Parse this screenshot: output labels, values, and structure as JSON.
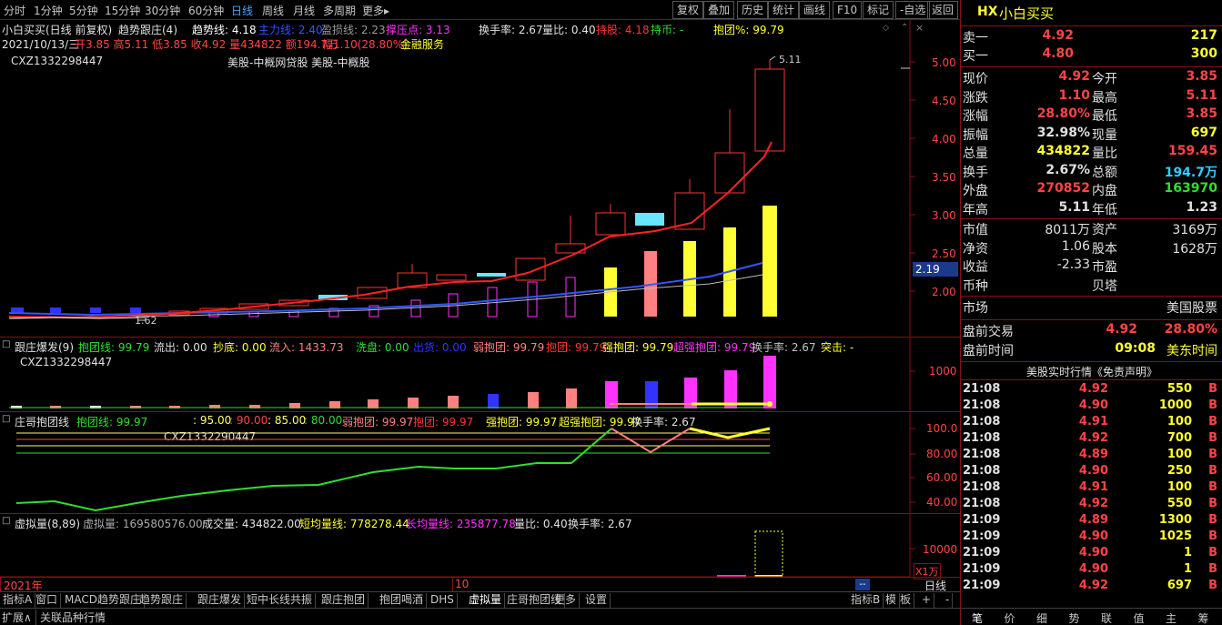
{
  "toolbar": {
    "periods": [
      "分时",
      "1分钟",
      "5分钟",
      "15分钟",
      "30分钟",
      "60分钟",
      "日线",
      "周线",
      "月线",
      "多周期",
      "更多▸"
    ],
    "active": "日线",
    "right_buttons": [
      "复权",
      "叠加",
      "历史",
      "统计",
      "画线",
      "F10",
      "标记",
      "-自选",
      "返回"
    ]
  },
  "main_header": {
    "title": "小白买买(日线 前复权)",
    "indicator": "趋势跟庄(4)",
    "trend_label": "趋势线: 4.18",
    "main_label": "主力线: 2.40",
    "stoploss_label": "盈损线: 2.23",
    "pressure_label": "撑压点: 3.13",
    "turnover": "换手率: 2.67",
    "volratio": "量比: 0.40",
    "holdstock": "持股: 4.18",
    "holdcoin": "持币: -",
    "hugpct": "抱团%: 99.79",
    "date_line_date": "2021/10/13/三",
    "date_line_rest": "开3.85 高5.11 低3.85 收4.92 量434822 额194.7万",
    "pct_text": "幅1.10(28.80%)",
    "finance": "金融服务",
    "code": "CXZ1332298447",
    "sector": "美股-中概网贷股 美股-中概股",
    "high_mark": "5.11",
    "low_mark": "1.62",
    "yaxis": [
      "5.00",
      "4.50",
      "4.00",
      "3.50",
      "3.00",
      "2.50",
      "2.00"
    ],
    "price_tag": "2.19"
  },
  "panel2": {
    "name": "跟庄爆发(9)",
    "items": [
      {
        "t": "抱团线: 99.79",
        "c": "#33dd33"
      },
      {
        "t": "流出: 0.00",
        "c": "#e0e0e0"
      },
      {
        "t": "抄底: 0.00",
        "c": "#ffff33"
      },
      {
        "t": "流入: 1433.73",
        "c": "#ff8080"
      },
      {
        "t": "洗盘: 0.00",
        "c": "#33dd33"
      },
      {
        "t": "出货: 0.00",
        "c": "#3333ff"
      },
      {
        "t": "弱抱团: 99.79",
        "c": "#ff8080"
      },
      {
        "t": "抱团: 99.79",
        "c": "#ff3333"
      },
      {
        "t": "强抱团: 99.79",
        "c": "#ffff33"
      },
      {
        "t": "超强抱团: 99.79",
        "c": "#ff33ff"
      },
      {
        "t": "换手率: 2.67",
        "c": "#c0c0c0"
      },
      {
        "t": "突击: -",
        "c": "#ffff33"
      }
    ],
    "code": "CXZ1332298447",
    "yaxis": [
      "1000"
    ]
  },
  "panel3": {
    "name": "庄哥抱团线",
    "items": [
      {
        "t": "抱团线: 99.97",
        "c": "#33dd33"
      },
      {
        "t": ": 95.00",
        "c": "#ffff66"
      },
      {
        "t": ": 90.00",
        "c": "#ff4444"
      },
      {
        "t": ": 85.00",
        "c": "#ffff66"
      },
      {
        "t": ": 80.00",
        "c": "#33dd33"
      },
      {
        "t": "弱抱团: 99.97",
        "c": "#ff8080"
      },
      {
        "t": "抱团: 99.97",
        "c": "#ff3333"
      },
      {
        "t": "强抱团: 99.97",
        "c": "#ffff33"
      },
      {
        "t": "超强抱团: 99.97",
        "c": "#ffff33"
      },
      {
        "t": "换手率: 2.67",
        "c": "#e0e0e0"
      }
    ],
    "code": "CXZ1332290447",
    "yaxis": [
      "100.0",
      "80.00",
      "60.00",
      "40.00"
    ]
  },
  "panel4": {
    "name": "虚拟量(8,89)",
    "vvol": "虚拟量: 169580576.00",
    "vol": "成交量: 434822.00",
    "short": "短均量线: 778278.44",
    "long": "长均量线: 235877.78",
    "ratio": "量比: 0.40",
    "turn": "换手率: 2.67",
    "yaxis": [
      "10000"
    ],
    "unit": "X1万"
  },
  "timeaxis": {
    "year": "2021年",
    "month": "10",
    "period": "日线"
  },
  "bottom_tabs": [
    "指标A",
    "窗口",
    "MACD趋势跟庄",
    "趋势跟庄",
    "跟庄爆发",
    "短中长线共振",
    "跟庄抱团",
    "抱团喝酒",
    "DHS",
    "虚拟量",
    "庄哥抱团线",
    "更多",
    "设置"
  ],
  "bottom_right_tabs": [
    "指标B",
    "模",
    "板",
    "+",
    "-"
  ],
  "bottom_bar": [
    "扩展∧",
    "关联品种行情"
  ],
  "right_panel": {
    "logo": "HX",
    "name": "小白买买",
    "sell1": {
      "label": "卖一",
      "price": "4.92",
      "vol": "217"
    },
    "buy1": {
      "label": "买一",
      "price": "4.80",
      "vol": "300"
    },
    "quotes": [
      {
        "l1": "现价",
        "v1": "4.92",
        "c1": "#ff4444",
        "l2": "今开",
        "v2": "3.85",
        "c2": "#ff4444"
      },
      {
        "l1": "涨跌",
        "v1": "1.10",
        "c1": "#ff4444",
        "l2": "最高",
        "v2": "5.11",
        "c2": "#ff4444"
      },
      {
        "l1": "涨幅",
        "v1": "28.80%",
        "c1": "#ff4444",
        "l2": "最低",
        "v2": "3.85",
        "c2": "#ff4444"
      },
      {
        "l1": "振幅",
        "v1": "32.98%",
        "c1": "#e0e0e0",
        "l2": "现量",
        "v2": "697",
        "c2": "#ffff33"
      },
      {
        "l1": "总量",
        "v1": "434822",
        "c1": "#ffff33",
        "l2": "量比",
        "v2": "159.45",
        "c2": "#ff4444"
      },
      {
        "l1": "换手",
        "v1": "2.67%",
        "c1": "#e0e0e0",
        "l2": "总额",
        "v2": "194.7万",
        "c2": "#33ccff"
      },
      {
        "l1": "外盘",
        "v1": "270852",
        "c1": "#ff4444",
        "l2": "内盘",
        "v2": "163970",
        "c2": "#33dd33"
      },
      {
        "l1": "年高",
        "v1": "5.11",
        "c1": "#e0e0e0",
        "l2": "年低",
        "v2": "1.23",
        "c2": "#e0e0e0"
      }
    ],
    "fund": [
      {
        "l1": "市值",
        "v1": "8011万",
        "l2": "资产",
        "v2": "3169万"
      },
      {
        "l1": "净资",
        "v1": "1.06",
        "l2": "股本",
        "v2": "1628万"
      },
      {
        "l1": "收益",
        "v1": "-2.33",
        "l2": "市盈",
        "v2": ""
      },
      {
        "l1": "币种",
        "v1": "",
        "l2": "贝塔",
        "v2": ""
      }
    ],
    "market_label": "市场",
    "market_value": "美国股票",
    "pre_label": "盘前交易",
    "pre_price": "4.92",
    "pre_pct": "28.80%",
    "pre_time_label": "盘前时间",
    "pre_time": "09:08",
    "pre_tz": "美东时间",
    "trades_title": "美股实时行情《免责声明》",
    "trades": [
      {
        "t": "21:08",
        "p": "4.92",
        "v": "550",
        "s": "B"
      },
      {
        "t": "21:08",
        "p": "4.90",
        "v": "1000",
        "s": "B"
      },
      {
        "t": "21:08",
        "p": "4.91",
        "v": "100",
        "s": "B"
      },
      {
        "t": "21:08",
        "p": "4.92",
        "v": "700",
        "s": "B"
      },
      {
        "t": "21:08",
        "p": "4.89",
        "v": "100",
        "s": "B"
      },
      {
        "t": "21:08",
        "p": "4.90",
        "v": "250",
        "s": "B"
      },
      {
        "t": "21:08",
        "p": "4.91",
        "v": "100",
        "s": "B"
      },
      {
        "t": "21:08",
        "p": "4.92",
        "v": "550",
        "s": "B"
      },
      {
        "t": "21:09",
        "p": "4.89",
        "v": "1300",
        "s": "B"
      },
      {
        "t": "21:09",
        "p": "4.90",
        "v": "1025",
        "s": "B"
      },
      {
        "t": "21:09",
        "p": "4.90",
        "v": "1",
        "s": "B"
      },
      {
        "t": "21:09",
        "p": "4.90",
        "v": "1",
        "s": "B"
      },
      {
        "t": "21:09",
        "p": "4.92",
        "v": "697",
        "s": "B"
      }
    ],
    "bottom_tabs": [
      "笔",
      "价",
      "细",
      "势",
      "联",
      "值",
      "主",
      "筹"
    ]
  }
}
